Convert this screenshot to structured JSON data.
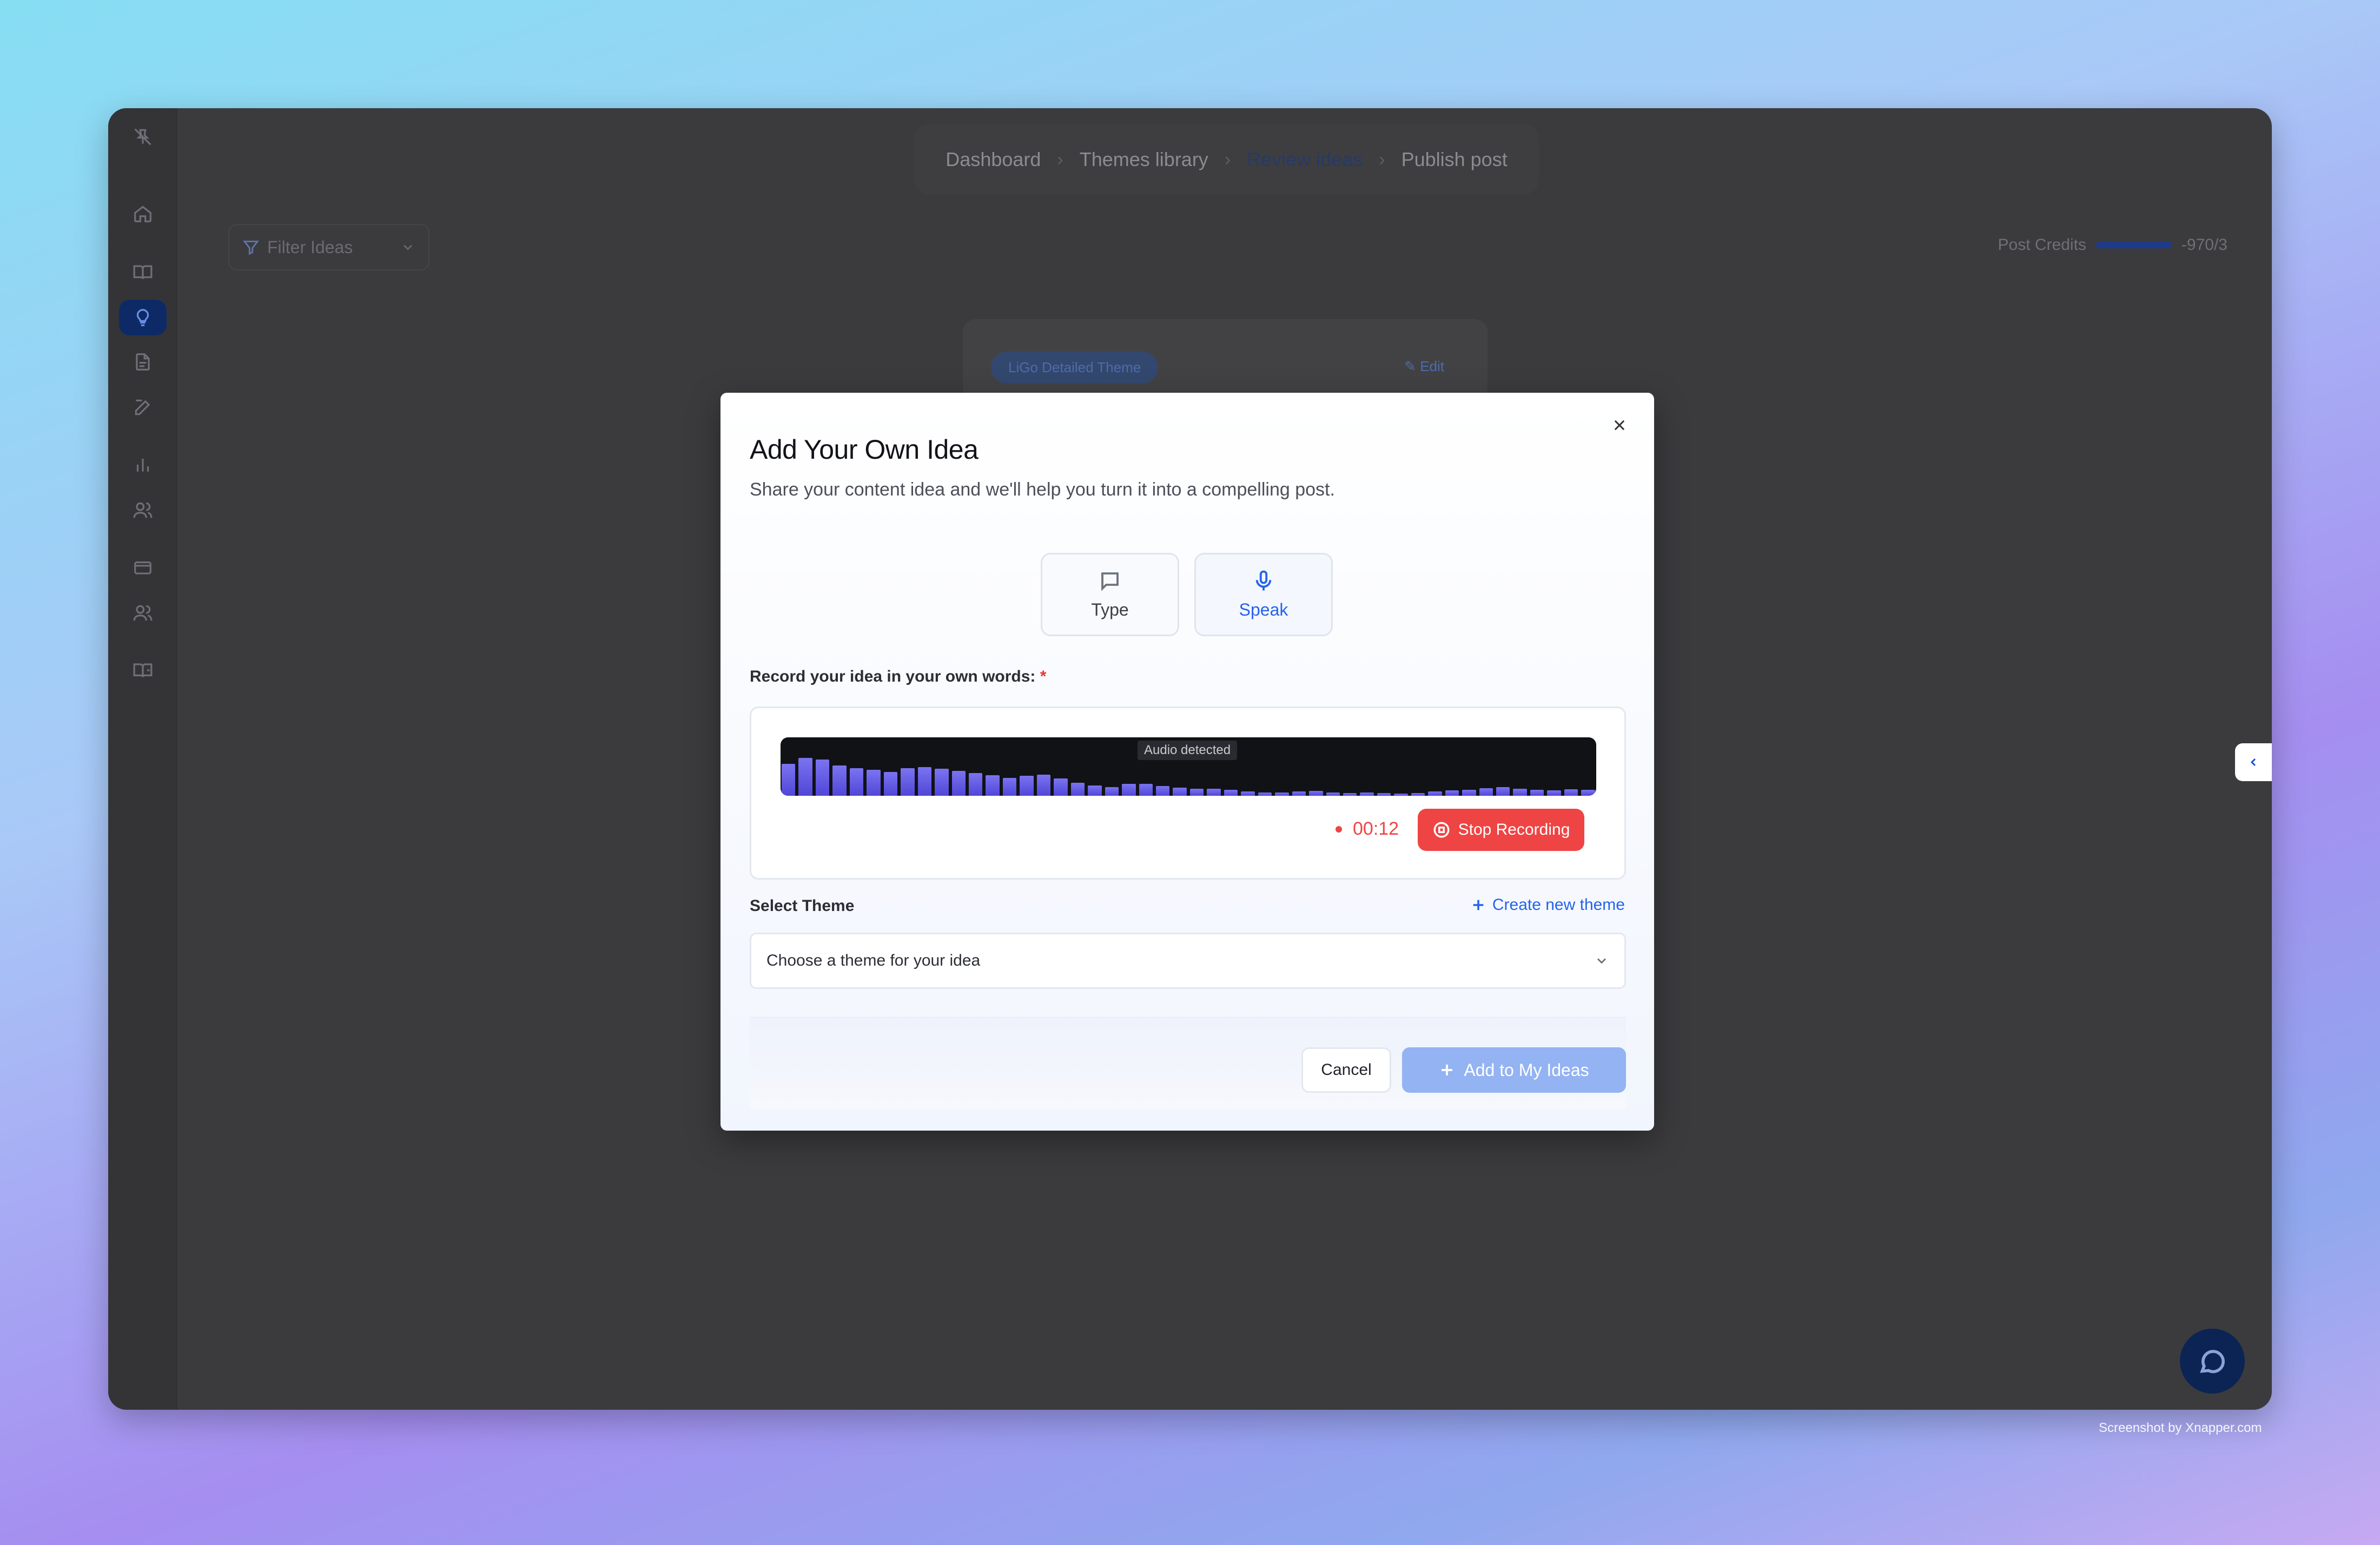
{
  "breadcrumb": {
    "items": [
      "Dashboard",
      "Themes library",
      "Review ideas",
      "Publish post"
    ],
    "current_index": 2
  },
  "filter": {
    "label": "Filter Ideas"
  },
  "credits": {
    "label": "Post Credits",
    "value": "-970/3",
    "fill_fraction": 1.0
  },
  "background_card": {
    "tag": "LiGo Detailed Theme",
    "edit_label": "Edit"
  },
  "sidebar": {
    "icons": [
      "pin-off-icon",
      "home-icon",
      "book-open-icon",
      "lightbulb-icon",
      "document-icon",
      "edit-icon",
      "bar-chart-icon",
      "users-icon",
      "credit-card-icon",
      "team-icon",
      "book-icon"
    ],
    "active": "lightbulb-icon"
  },
  "modal": {
    "title": "Add Your Own Idea",
    "subtitle": "Share your content idea and we'll help you turn it into a compelling post.",
    "modes": [
      {
        "label": "Type",
        "icon": "message-square-icon"
      },
      {
        "label": "Speak",
        "icon": "microphone-icon",
        "selected": true
      }
    ],
    "record_label": "Record your idea in your own words:",
    "required_marker": "*",
    "audio_tag": "Audio detected",
    "waveform_levels": [
      0.55,
      0.65,
      0.62,
      0.52,
      0.47,
      0.44,
      0.41,
      0.47,
      0.49,
      0.46,
      0.43,
      0.39,
      0.35,
      0.31,
      0.34,
      0.36,
      0.3,
      0.22,
      0.18,
      0.15,
      0.2,
      0.2,
      0.17,
      0.14,
      0.12,
      0.12,
      0.1,
      0.07,
      0.06,
      0.06,
      0.07,
      0.08,
      0.06,
      0.05,
      0.06,
      0.05,
      0.04,
      0.05,
      0.07,
      0.09,
      0.1,
      0.13,
      0.15,
      0.12,
      0.1,
      0.09,
      0.11,
      0.1
    ],
    "timer": "00:12",
    "stop_label": "Stop Recording",
    "theme_label": "Select Theme",
    "create_theme_label": "Create new theme",
    "theme_placeholder": "Choose a theme for your idea",
    "cancel_label": "Cancel",
    "add_label": "Add to My Ideas"
  },
  "watermark": "Screenshot by Xnapper.com",
  "colors": {
    "accent": "#2563eb",
    "danger": "#ef4444",
    "primary_disabled": "#93b3f2"
  }
}
